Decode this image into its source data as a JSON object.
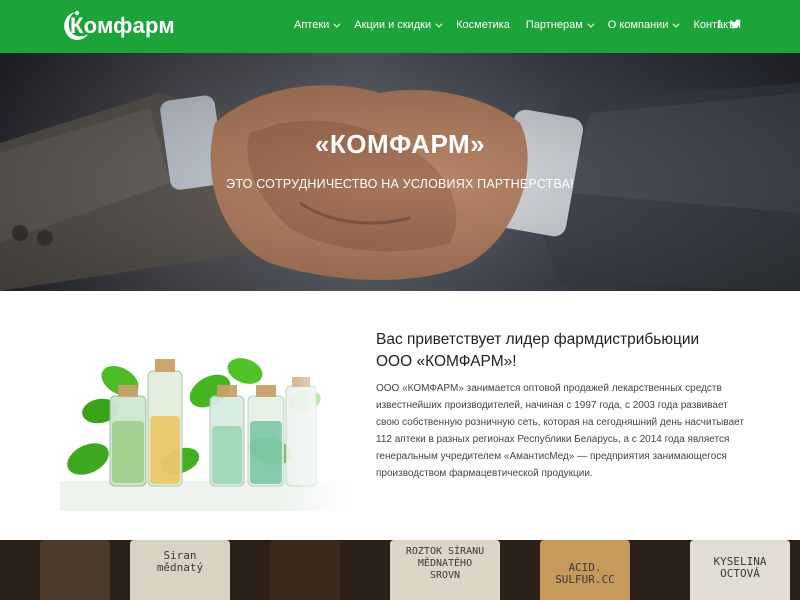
{
  "header": {
    "logo_text": "Комфарм",
    "nav": [
      {
        "label": "Аптеки",
        "has_dropdown": true
      },
      {
        "label": "Акции и скидки",
        "has_dropdown": true
      },
      {
        "label": "Косметика",
        "has_dropdown": false
      },
      {
        "label": "Партнерам",
        "has_dropdown": true
      },
      {
        "label": "О компании",
        "has_dropdown": true
      },
      {
        "label": "Контакты",
        "has_dropdown": false
      }
    ],
    "social": {
      "facebook": "f",
      "twitter": "t"
    }
  },
  "hero": {
    "title": "«КОМФАРМ»",
    "subtitle": "ЭТО СОТРУДНИЧЕСТВО НА УСЛОВИЯХ ПАРТНЕРСТВА!"
  },
  "welcome": {
    "title": "Вас приветствует лидер фармдистрибьюции ООО «КОМФАРМ»!",
    "text": "ООО «КОМФАРМ» занимается оптовой продажей лекарственных средств известнейших производителей, начиная с 1997 года, с 2003 года развивает свою собственную розничную сеть, которая на сегодняшний день насчитывает 112 аптеки в разных регионах Республики Беларусь, а с 2014 года является генеральным учредителем «АмантисМед» — предприятия занимающегося производством фармацевтической продукции."
  },
  "band": {
    "labels": [
      "Siran\nmědnatý",
      "ROZTOK SÍRANU\nMĚDNATÉHO\nSROVN",
      "ACID.\nSULFUR.CC",
      "KYSELINA\nOCTOVÁ"
    ]
  },
  "colors": {
    "brand_green": "#1ca33a",
    "white": "#ffffff"
  }
}
